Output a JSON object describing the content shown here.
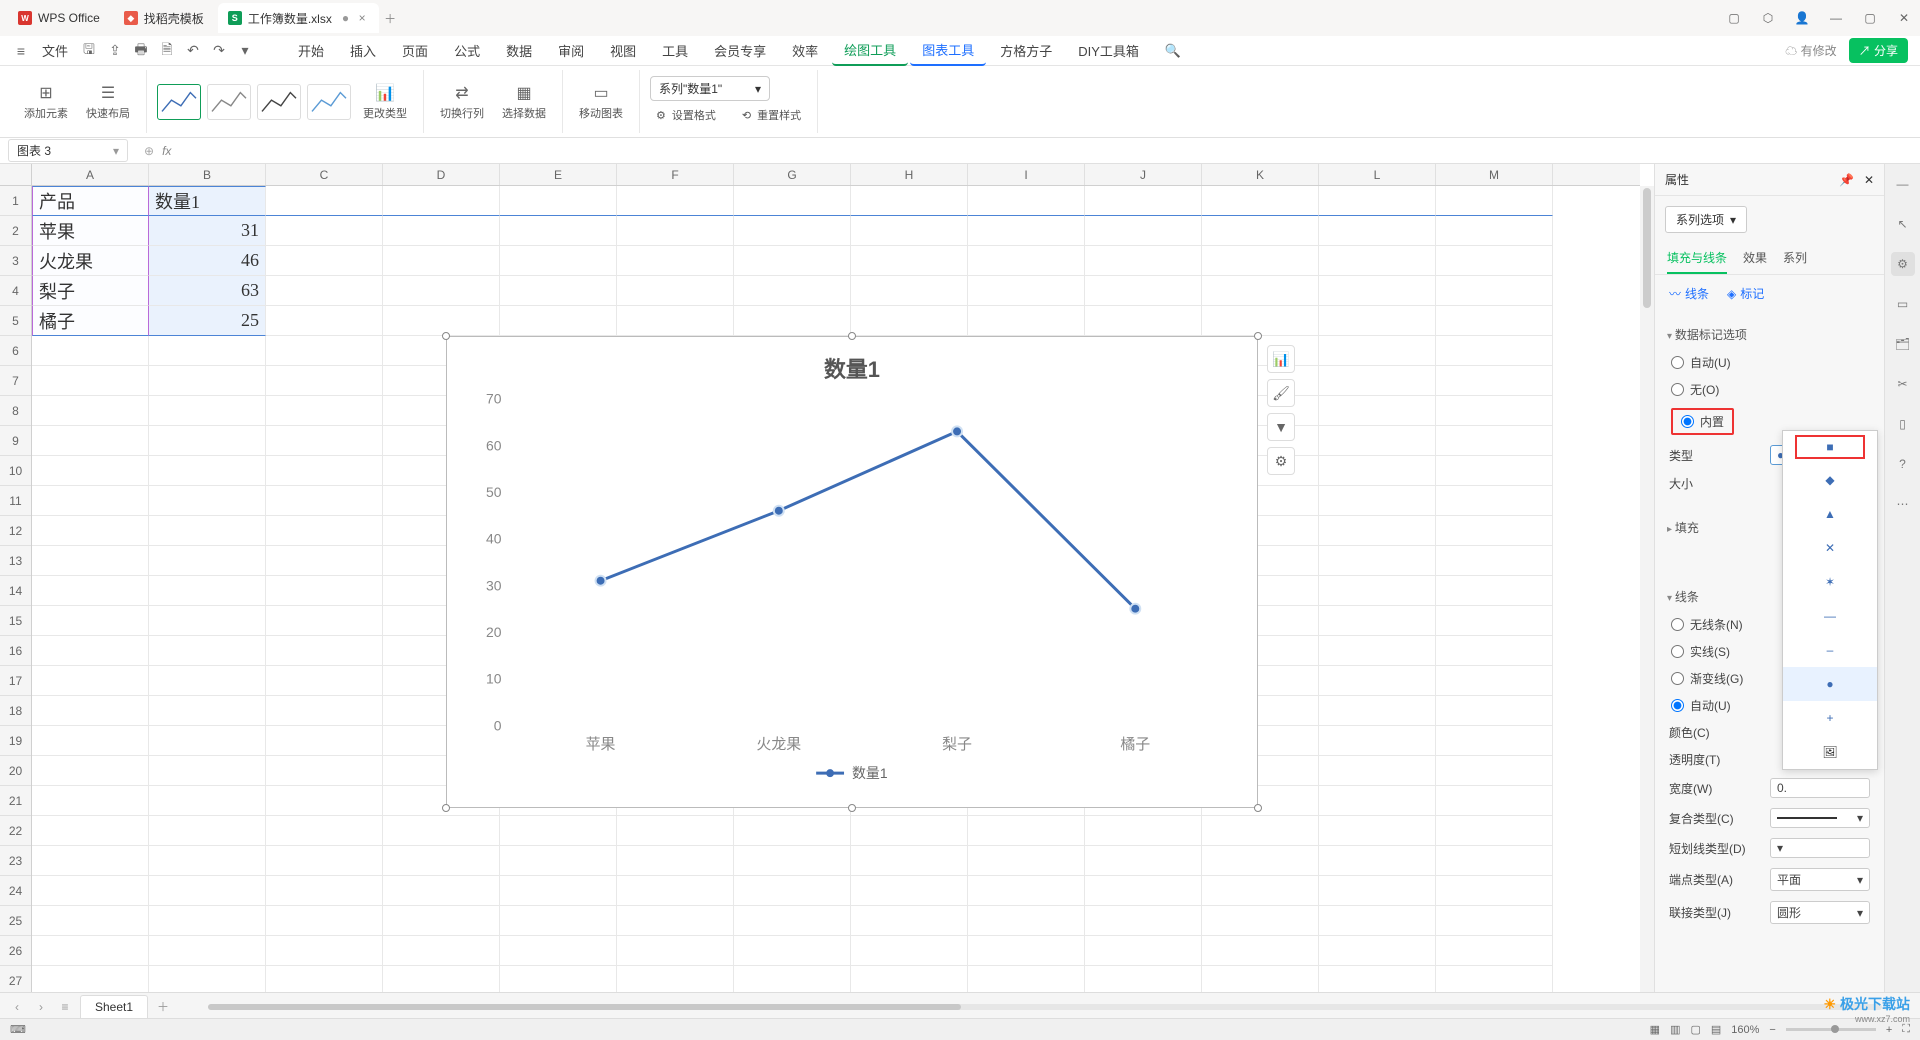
{
  "tabs": [
    {
      "label": "WPS Office",
      "icon": "wps"
    },
    {
      "label": "找稻壳模板",
      "icon": "tpl"
    },
    {
      "label": "工作簿数量.xlsx",
      "icon": "xls",
      "active": true,
      "dirty": "●"
    }
  ],
  "quick": {
    "file": "文件"
  },
  "menubar": [
    "开始",
    "插入",
    "页面",
    "公式",
    "数据",
    "审阅",
    "视图",
    "工具",
    "会员专享",
    "效率"
  ],
  "menubar_chart": [
    "绘图工具",
    "图表工具"
  ],
  "menubar_right": [
    "方格方子",
    "DIY工具箱"
  ],
  "header_right": {
    "pending": "有修改",
    "share": "分享"
  },
  "ribbon": {
    "add_element": "添加元素",
    "quick_layout": "快速布局",
    "change_type": "更改类型",
    "swap_rc": "切换行列",
    "select_data": "选择数据",
    "move_chart": "移动图表",
    "set_format": "设置格式",
    "reset_style": "重置样式",
    "series_selector": "系列\"数量1\""
  },
  "namebox": "图表 3",
  "columns": [
    "A",
    "B",
    "C",
    "D",
    "E",
    "F",
    "G",
    "H",
    "I",
    "J",
    "K",
    "L",
    "M"
  ],
  "data_rows": [
    {
      "A": "产品",
      "B": "数量1"
    },
    {
      "A": "苹果",
      "B": "31"
    },
    {
      "A": "火龙果",
      "B": "46"
    },
    {
      "A": "梨子",
      "B": "63"
    },
    {
      "A": "橘子",
      "B": "25"
    }
  ],
  "chart_data": {
    "type": "line",
    "title": "数量1",
    "categories": [
      "苹果",
      "火龙果",
      "梨子",
      "橘子"
    ],
    "series": [
      {
        "name": "数量1",
        "values": [
          31,
          46,
          63,
          25
        ]
      }
    ],
    "ylim": [
      0,
      70
    ],
    "ytick": 10,
    "legend": "数量1"
  },
  "panel": {
    "title": "属性",
    "series_options": "系列选项",
    "tabs": [
      "填充与线条",
      "效果",
      "系列"
    ],
    "subtabs": [
      "线条",
      "标记"
    ],
    "marker_section": "数据标记选项",
    "marker_auto": "自动(U)",
    "marker_none": "无(O)",
    "marker_builtin": "内置",
    "type_label": "类型",
    "size_label": "大小",
    "fill_section": "填充",
    "line_section": "线条",
    "line_none": "无线条(N)",
    "line_solid": "实线(S)",
    "line_grad": "渐变线(G)",
    "line_auto": "自动(U)",
    "color_label": "颜色(C)",
    "trans_label": "透明度(T)",
    "width_label": "宽度(W)",
    "width_value": "0.",
    "compound_label": "复合类型(C)",
    "dash_label": "短划线类型(D)",
    "cap_label": "端点类型(A)",
    "cap_value": "平面",
    "join_label": "联接类型(J)",
    "join_value": "圆形"
  },
  "sheet": {
    "name": "Sheet1"
  },
  "status": {
    "zoom": "160%"
  },
  "watermark": {
    "site": "极光下载站",
    "url": "www.xz7.com"
  }
}
